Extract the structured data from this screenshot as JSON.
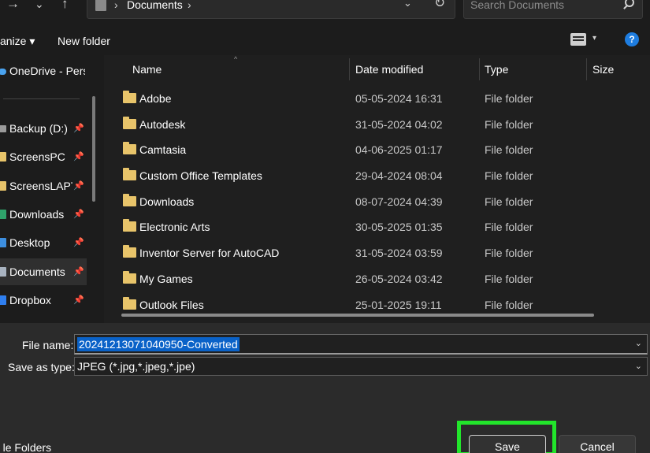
{
  "toolbar": {
    "forward_glyph": "→",
    "recent_glyph": "⌄",
    "up_glyph": "↑",
    "breadcrumb_sep": "›",
    "breadcrumb": "Documents",
    "dropdown_glyph": "⌄",
    "refresh_glyph": "↻",
    "search_placeholder": "Search Documents"
  },
  "commandbar": {
    "organize": "anize ▾",
    "new_folder": "New folder",
    "view_dropdown": "▾",
    "help": "?"
  },
  "navpane": {
    "pin_glyph": "📌",
    "items": [
      {
        "label": "OneDrive - Perso",
        "icon": "onedrive-icon",
        "color": "#4aa3ef",
        "pinned": false,
        "selected": false
      },
      {
        "label": "Backup (D:)",
        "icon": "drive-icon",
        "color": "#9a9a9a",
        "pinned": true,
        "selected": false
      },
      {
        "label": "ScreensPC",
        "icon": "folder-icon",
        "color": "#e8c46a",
        "pinned": true,
        "selected": false
      },
      {
        "label": "ScreensLAPTOP",
        "icon": "folder-icon",
        "color": "#e8c46a",
        "pinned": true,
        "selected": false
      },
      {
        "label": "Downloads",
        "icon": "download-icon",
        "color": "#2fa36b",
        "pinned": true,
        "selected": false
      },
      {
        "label": "Desktop",
        "icon": "desktop-icon",
        "color": "#3d8fe0",
        "pinned": true,
        "selected": false
      },
      {
        "label": "Documents",
        "icon": "documents-icon",
        "color": "#a8b3c0",
        "pinned": true,
        "selected": true
      },
      {
        "label": "Dropbox",
        "icon": "dropbox-icon",
        "color": "#2f7ff0",
        "pinned": true,
        "selected": false
      }
    ]
  },
  "filelist": {
    "sort_glyph": "^",
    "columns": {
      "name": "Name",
      "date": "Date modified",
      "type": "Type",
      "size": "Size"
    },
    "rows": [
      {
        "name": "Adobe",
        "date": "05-05-2024 16:31",
        "type": "File folder"
      },
      {
        "name": "Autodesk",
        "date": "31-05-2024 04:02",
        "type": "File folder"
      },
      {
        "name": "Camtasia",
        "date": "04-06-2025 01:17",
        "type": "File folder"
      },
      {
        "name": "Custom Office Templates",
        "date": "29-04-2024 08:04",
        "type": "File folder"
      },
      {
        "name": "Downloads",
        "date": "08-07-2024 04:39",
        "type": "File folder"
      },
      {
        "name": "Electronic Arts",
        "date": "30-05-2025 01:35",
        "type": "File folder"
      },
      {
        "name": "Inventor Server for AutoCAD",
        "date": "31-05-2024 03:59",
        "type": "File folder"
      },
      {
        "name": "My Games",
        "date": "26-05-2024 03:42",
        "type": "File folder"
      },
      {
        "name": "Outlook Files",
        "date": "25-01-2025 19:11",
        "type": "File folder"
      }
    ]
  },
  "saveform": {
    "file_name_label": "File name:",
    "file_name_value": "20241213071040950-Converted",
    "save_as_type_label": "Save as type:",
    "save_as_type_value": "JPEG (*.jpg,*.jpeg,*.jpe)",
    "dropdown_glyph": "⌄",
    "hide_folders_caret": "⌃",
    "hide_folders": "le Folders",
    "save_button": "Save",
    "cancel_button": "Cancel",
    "highlight_color": "#22e52b"
  }
}
